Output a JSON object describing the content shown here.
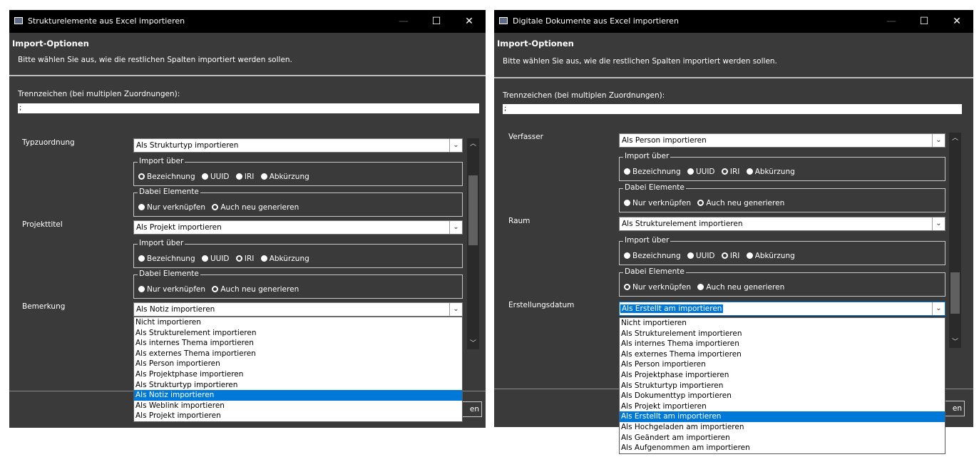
{
  "left": {
    "window_title": "Strukturelemente aus Excel importieren",
    "header_title": "Import-Optionen",
    "header_subtitle": "Bitte wählen Sie aus, wie die restlichen Spalten importiert werden sollen.",
    "separator_label": "Trennzeichen (bei multiplen Zuordnungen):",
    "separator_value": ";",
    "rows": [
      {
        "label": "Typzuordnung",
        "value": "Als Strukturtyp importieren",
        "import_group": {
          "legend": "Import über",
          "options": [
            "Bezeichnung",
            "UUID",
            "IRI",
            "Abkürzung"
          ],
          "selected": "Bezeichnung"
        },
        "elements_group": {
          "legend": "Dabei Elemente",
          "options": [
            "Nur verknüpfen",
            "Auch neu generieren"
          ],
          "selected": "Auch neu generieren"
        }
      },
      {
        "label": "Projekttitel",
        "value": "Als Projekt importieren",
        "import_group": {
          "legend": "Import über",
          "options": [
            "Bezeichnung",
            "UUID",
            "IRI",
            "Abkürzung"
          ],
          "selected": "IRI"
        },
        "elements_group": {
          "legend": "Dabei Elemente",
          "options": [
            "Nur verknüpfen",
            "Auch neu generieren"
          ],
          "selected": "Auch neu generieren"
        }
      },
      {
        "label": "Bemerkung",
        "value": "Als Notiz importieren"
      }
    ],
    "dropdown_options": [
      "Nicht importieren",
      "Als Strukturelement importieren",
      "Als internes Thema importieren",
      "Als externes Thema importieren",
      "Als Person importieren",
      "Als Projektphase importieren",
      "Als Strukturtyp importieren",
      "Als Notiz importieren",
      "Als Weblink importieren",
      "Als Projekt importieren"
    ],
    "dropdown_selected": "Als Notiz importieren",
    "footer_button_partial": "en"
  },
  "right": {
    "window_title": "Digitale Dokumente aus Excel importieren",
    "header_title": "Import-Optionen",
    "header_subtitle": "Bitte wählen Sie aus, wie die restlichen Spalten importiert werden sollen.",
    "separator_label": "Trennzeichen (bei multiplen Zuordnungen):",
    "separator_value": ";",
    "rows": [
      {
        "label": "Verfasser",
        "value": "Als Person importieren",
        "import_group": {
          "legend": "Import über",
          "options": [
            "Bezeichnung",
            "UUID",
            "IRI",
            "Abkürzung"
          ],
          "selected": "IRI"
        },
        "elements_group": {
          "legend": "Dabei Elemente",
          "options": [
            "Nur verknüpfen",
            "Auch neu generieren"
          ],
          "selected": "Auch neu generieren"
        }
      },
      {
        "label": "Raum",
        "value": "Als Strukturelement importieren",
        "import_group": {
          "legend": "Import über",
          "options": [
            "Bezeichnung",
            "UUID",
            "IRI",
            "Abkürzung"
          ],
          "selected": "IRI"
        },
        "elements_group": {
          "legend": "Dabei Elemente",
          "options": [
            "Nur verknüpfen",
            "Auch neu generieren"
          ],
          "selected": "Nur verknüpfen"
        }
      },
      {
        "label": "Erstellungsdatum",
        "value": "Als Erstellt am importieren"
      }
    ],
    "dropdown_options": [
      "Nicht importieren",
      "Als Strukturelement importieren",
      "Als internes Thema importieren",
      "Als externes Thema importieren",
      "Als Person importieren",
      "Als Projektphase importieren",
      "Als Strukturtyp importieren",
      "Als Dokumenttyp importieren",
      "Als Projekt importieren",
      "Als Erstellt am importieren",
      "Als Hochgeladen am importieren",
      "Als Geändert am importieren",
      "Als Aufgenommen am importieren"
    ],
    "dropdown_selected": "Als Erstellt am importieren",
    "footer_button_partial": "en"
  },
  "icons": {
    "minimize": "minimize-icon",
    "maximize": "maximize-icon",
    "close": "close-icon",
    "chevron": "chevron-down-icon"
  },
  "colors": {
    "titlebar": "#000000",
    "window_bg": "#3a3a3a",
    "selection": "#0078d7"
  }
}
